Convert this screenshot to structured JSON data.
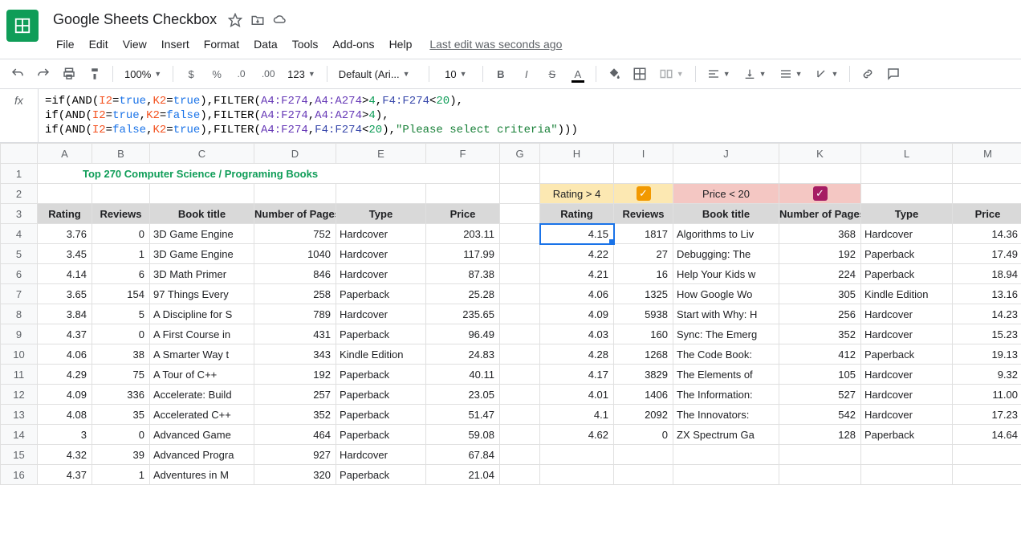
{
  "doc_title": "Google Sheets Checkbox",
  "edit_status": "Last edit was seconds ago",
  "menu": [
    "File",
    "Edit",
    "View",
    "Insert",
    "Format",
    "Data",
    "Tools",
    "Add-ons",
    "Help"
  ],
  "toolbar": {
    "zoom": "100%",
    "font": "Default (Ari...",
    "size": "10",
    "more": "123"
  },
  "formula_lines": [
    [
      {
        "t": "=if(",
        "c": "fn"
      },
      {
        "t": "AND",
        "c": "fn"
      },
      {
        "t": "(",
        "c": "fn"
      },
      {
        "t": "I2",
        "c": "ref"
      },
      {
        "t": "=",
        "c": "fn"
      },
      {
        "t": "true",
        "c": "kw"
      },
      {
        "t": ",",
        "c": "fn"
      },
      {
        "t": "K2",
        "c": "ref"
      },
      {
        "t": "=",
        "c": "fn"
      },
      {
        "t": "true",
        "c": "kw"
      },
      {
        "t": "),",
        "c": "fn"
      },
      {
        "t": "FILTER",
        "c": "fn"
      },
      {
        "t": "(",
        "c": "fn"
      },
      {
        "t": "A4:F274",
        "c": "rng"
      },
      {
        "t": ",",
        "c": "fn"
      },
      {
        "t": "A4:A274",
        "c": "rng"
      },
      {
        "t": ">",
        "c": "fn"
      },
      {
        "t": "4",
        "c": "num"
      },
      {
        "t": ",",
        "c": "fn"
      },
      {
        "t": "F4:F274",
        "c": "rng2"
      },
      {
        "t": "<",
        "c": "fn"
      },
      {
        "t": "20",
        "c": "num"
      },
      {
        "t": "),",
        "c": "fn"
      }
    ],
    [
      {
        "t": "if(",
        "c": "fn"
      },
      {
        "t": "AND",
        "c": "fn"
      },
      {
        "t": "(",
        "c": "fn"
      },
      {
        "t": "I2",
        "c": "ref"
      },
      {
        "t": "=",
        "c": "fn"
      },
      {
        "t": "true",
        "c": "kw"
      },
      {
        "t": ",",
        "c": "fn"
      },
      {
        "t": "K2",
        "c": "ref"
      },
      {
        "t": "=",
        "c": "fn"
      },
      {
        "t": "false",
        "c": "kw"
      },
      {
        "t": "),",
        "c": "fn"
      },
      {
        "t": "FILTER",
        "c": "fn"
      },
      {
        "t": "(",
        "c": "fn"
      },
      {
        "t": "A4:F274",
        "c": "rng"
      },
      {
        "t": ",",
        "c": "fn"
      },
      {
        "t": "A4:A274",
        "c": "rng"
      },
      {
        "t": ">",
        "c": "fn"
      },
      {
        "t": "4",
        "c": "num"
      },
      {
        "t": "),",
        "c": "fn"
      }
    ],
    [
      {
        "t": "if(",
        "c": "fn"
      },
      {
        "t": "AND",
        "c": "fn"
      },
      {
        "t": "(",
        "c": "fn"
      },
      {
        "t": "I2",
        "c": "ref"
      },
      {
        "t": "=",
        "c": "fn"
      },
      {
        "t": "false",
        "c": "kw"
      },
      {
        "t": ",",
        "c": "fn"
      },
      {
        "t": "K2",
        "c": "ref"
      },
      {
        "t": "=",
        "c": "fn"
      },
      {
        "t": "true",
        "c": "kw"
      },
      {
        "t": "),",
        "c": "fn"
      },
      {
        "t": "FILTER",
        "c": "fn"
      },
      {
        "t": "(",
        "c": "fn"
      },
      {
        "t": "A4:F274",
        "c": "rng"
      },
      {
        "t": ",",
        "c": "fn"
      },
      {
        "t": "F4:F274",
        "c": "rng2"
      },
      {
        "t": "<",
        "c": "fn"
      },
      {
        "t": "20",
        "c": "num"
      },
      {
        "t": "),",
        "c": "fn"
      },
      {
        "t": "\"Please select criteria\"",
        "c": "str"
      },
      {
        "t": ")))",
        "c": "fn"
      }
    ]
  ],
  "columns": [
    "A",
    "B",
    "C",
    "D",
    "E",
    "F",
    "G",
    "H",
    "I",
    "J",
    "K",
    "L",
    "M"
  ],
  "title_row": "Top 270 Computer Science / Programing Books",
  "filter_labels": {
    "rating": "Rating > 4",
    "price": "Price < 20"
  },
  "headers": [
    "Rating",
    "Reviews",
    "Book title",
    "Number of Pages",
    "Type",
    "Price"
  ],
  "left_rows": [
    [
      "3.76",
      "0",
      "3D Game Engine",
      "752",
      "Hardcover",
      "203.11"
    ],
    [
      "3.45",
      "1",
      "3D Game Engine",
      "1040",
      "Hardcover",
      "117.99"
    ],
    [
      "4.14",
      "6",
      "3D Math Primer",
      "846",
      "Hardcover",
      "87.38"
    ],
    [
      "3.65",
      "154",
      "97 Things Every",
      "258",
      "Paperback",
      "25.28"
    ],
    [
      "3.84",
      "5",
      "A Discipline for S",
      "789",
      "Hardcover",
      "235.65"
    ],
    [
      "4.37",
      "0",
      "A First Course in",
      "431",
      "Paperback",
      "96.49"
    ],
    [
      "4.06",
      "38",
      "A Smarter Way t",
      "343",
      "Kindle Edition",
      "24.83"
    ],
    [
      "4.29",
      "75",
      "A Tour of C++",
      "192",
      "Paperback",
      "40.11"
    ],
    [
      "4.09",
      "336",
      "Accelerate: Build",
      "257",
      "Paperback",
      "23.05"
    ],
    [
      "4.08",
      "35",
      "Accelerated C++",
      "352",
      "Paperback",
      "51.47"
    ],
    [
      "3",
      "0",
      "Advanced Game",
      "464",
      "Paperback",
      "59.08"
    ],
    [
      "4.32",
      "39",
      "Advanced Progra",
      "927",
      "Hardcover",
      "67.84"
    ],
    [
      "4.37",
      "1",
      "Adventures in M",
      "320",
      "Paperback",
      "21.04"
    ]
  ],
  "right_rows": [
    [
      "4.15",
      "1817",
      "Algorithms to Liv",
      "368",
      "Hardcover",
      "14.36"
    ],
    [
      "4.22",
      "27",
      "Debugging: The",
      "192",
      "Paperback",
      "17.49"
    ],
    [
      "4.21",
      "16",
      "Help Your Kids w",
      "224",
      "Paperback",
      "18.94"
    ],
    [
      "4.06",
      "1325",
      "How Google Wo",
      "305",
      "Kindle Edition",
      "13.16"
    ],
    [
      "4.09",
      "5938",
      "Start with Why: H",
      "256",
      "Hardcover",
      "14.23"
    ],
    [
      "4.03",
      "160",
      "Sync: The Emerg",
      "352",
      "Hardcover",
      "15.23"
    ],
    [
      "4.28",
      "1268",
      "The Code Book:",
      "412",
      "Paperback",
      "19.13"
    ],
    [
      "4.17",
      "3829",
      "The Elements of",
      "105",
      "Hardcover",
      "9.32"
    ],
    [
      "4.01",
      "1406",
      "The Information:",
      "527",
      "Hardcover",
      "11.00"
    ],
    [
      "4.1",
      "2092",
      "The Innovators:",
      "542",
      "Hardcover",
      "17.23"
    ],
    [
      "4.62",
      "0",
      "ZX Spectrum Ga",
      "128",
      "Paperback",
      "14.64"
    ]
  ]
}
